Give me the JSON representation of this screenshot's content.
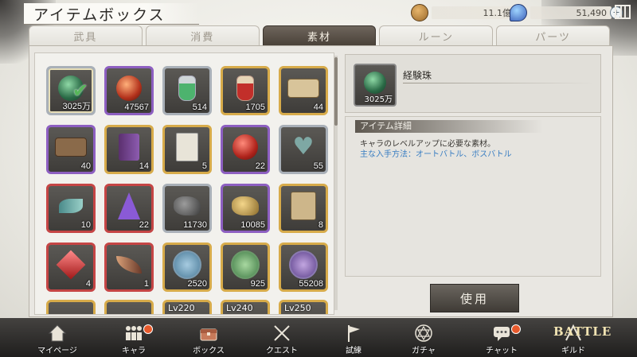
{
  "header": {
    "title": "アイテムボックス",
    "gold": "11.1億",
    "gems": "51,490",
    "plus": "+",
    "icons": {
      "gold": "coin-icon",
      "gems": "gem-icon",
      "gift": "present-box-icon"
    }
  },
  "tabs": [
    "武具",
    "消費",
    "素材",
    "ルーン",
    "パーツ"
  ],
  "active_tab": "素材",
  "items": [
    {
      "count": "3025万",
      "rarity": "silver",
      "icon": "green-orb",
      "selected": true
    },
    {
      "count": "47567",
      "rarity": "purple",
      "icon": "red-orb"
    },
    {
      "count": "514",
      "rarity": "silver",
      "icon": "green-potion"
    },
    {
      "count": "1705",
      "rarity": "gold",
      "icon": "red-potion"
    },
    {
      "count": "44",
      "rarity": "gold",
      "icon": "ticket"
    },
    {
      "count": "40",
      "rarity": "purple",
      "icon": "ticket-dark"
    },
    {
      "count": "14",
      "rarity": "gold",
      "icon": "purple-scroll"
    },
    {
      "count": "5",
      "rarity": "gold",
      "icon": "paper-scroll"
    },
    {
      "count": "22",
      "rarity": "purple",
      "icon": "red-apple"
    },
    {
      "count": "55",
      "rarity": "silver",
      "icon": "heart"
    },
    {
      "count": "10",
      "rarity": "red",
      "icon": "feather-leaf"
    },
    {
      "count": "22",
      "rarity": "red",
      "icon": "purple-crystal"
    },
    {
      "count": "11730",
      "rarity": "silver",
      "icon": "dark-ore"
    },
    {
      "count": "10085",
      "rarity": "purple",
      "icon": "gold-ore"
    },
    {
      "count": "8",
      "rarity": "gold",
      "icon": "parchment"
    },
    {
      "count": "4",
      "rarity": "red",
      "icon": "red-gem"
    },
    {
      "count": "1",
      "rarity": "red",
      "icon": "wing"
    },
    {
      "count": "2520",
      "rarity": "gold",
      "icon": "blue-seal"
    },
    {
      "count": "925",
      "rarity": "gold",
      "icon": "green-seal"
    },
    {
      "count": "55208",
      "rarity": "gold",
      "icon": "purple-seal"
    },
    {
      "lv": "",
      "rarity": "gold",
      "icon": "partial"
    },
    {
      "lv": "",
      "rarity": "gold",
      "icon": "partial"
    },
    {
      "lv": "Lv220",
      "rarity": "gold",
      "icon": "partial"
    },
    {
      "lv": "Lv240",
      "rarity": "gold",
      "icon": "partial"
    },
    {
      "lv": "Lv250",
      "rarity": "gold",
      "icon": "partial"
    }
  ],
  "detail": {
    "name": "経験珠",
    "count": "3025万",
    "section_title": "アイテム詳細",
    "description": "キャラのレベルアップに必要な素材。",
    "source": "主な入手方法：オートバトル、ボスバトル",
    "use_button": "使用"
  },
  "nav": {
    "items": [
      {
        "label": "マイページ",
        "icon": "house-icon"
      },
      {
        "label": "キャラ",
        "icon": "characters-icon",
        "badge": true
      },
      {
        "label": "ボックス",
        "icon": "chest-icon"
      },
      {
        "label": "クエスト",
        "icon": "crossed-swords-icon"
      },
      {
        "label": "試練",
        "icon": "flag-icon"
      },
      {
        "label": "ガチャ",
        "icon": "hexagram-icon"
      },
      {
        "label": "チャット",
        "icon": "chat-bubble-icon",
        "badge": true
      },
      {
        "label": "ギルド",
        "icon": "guild-icon"
      }
    ],
    "battle_label": "BATTLE"
  },
  "colors": {
    "purple": "#8d5fc1",
    "gold": "#d7ab4a",
    "red": "#c54545",
    "silver": "#a9b0b8",
    "badge": "#e85a2c",
    "link": "#3a7ec2"
  }
}
